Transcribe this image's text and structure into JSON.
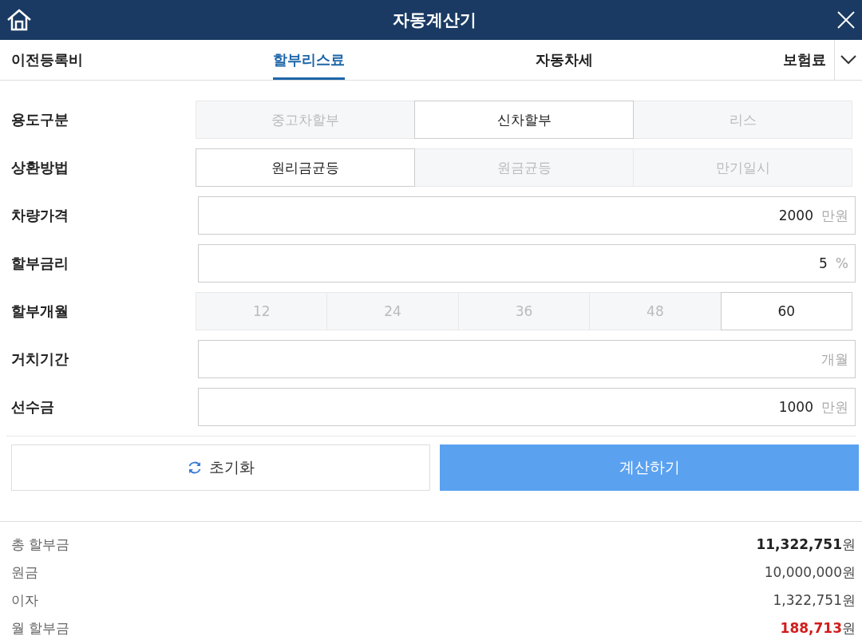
{
  "window": {
    "title": "자동계산기"
  },
  "tabs": [
    {
      "label": "이전등록비",
      "selected": false
    },
    {
      "label": "할부리스료",
      "selected": true
    },
    {
      "label": "자동차세",
      "selected": false
    },
    {
      "label": "보험료",
      "selected": false
    }
  ],
  "form": [
    {
      "kind": "segmented",
      "label": "용도구분",
      "options": [
        {
          "label": "중고차할부",
          "selected": false
        },
        {
          "label": "신차할부",
          "selected": true
        },
        {
          "label": "리스",
          "selected": false
        }
      ]
    },
    {
      "kind": "segmented",
      "label": "상환방법",
      "options": [
        {
          "label": "원리금균등",
          "selected": true
        },
        {
          "label": "원금균등",
          "selected": false
        },
        {
          "label": "만기일시",
          "selected": false
        }
      ]
    },
    {
      "kind": "input",
      "label": "차량가격",
      "value": "2000",
      "unit": "만원"
    },
    {
      "kind": "input",
      "label": "할부금리",
      "value": "5",
      "unit": "%"
    },
    {
      "kind": "segmented",
      "label": "할부개월",
      "options": [
        {
          "label": "12",
          "selected": false
        },
        {
          "label": "24",
          "selected": false
        },
        {
          "label": "36",
          "selected": false
        },
        {
          "label": "48",
          "selected": false
        },
        {
          "label": "60",
          "selected": true
        }
      ]
    },
    {
      "kind": "input",
      "label": "거치기간",
      "unit": "개월"
    },
    {
      "kind": "input",
      "label": "선수금",
      "value": "1000",
      "unit": "만원"
    }
  ],
  "buttons": {
    "reset": "초기화",
    "calculate": "계산하기"
  },
  "results": [
    {
      "label": "총 할부금",
      "value": "11,322,751",
      "unit": "원",
      "kind": "total"
    },
    {
      "label": "원금",
      "value": "10,000,000",
      "unit": "원",
      "kind": "plain"
    },
    {
      "label": "이자",
      "value": "1,322,751",
      "unit": "원",
      "kind": "plain"
    },
    {
      "label": "월 할부금",
      "value": "188,713",
      "unit": "원",
      "kind": "monthly"
    }
  ]
}
